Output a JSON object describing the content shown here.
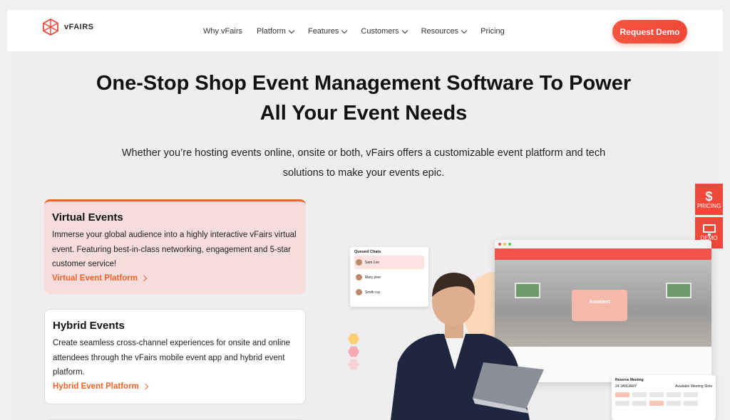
{
  "nav": {
    "logo_text": "vFAIRS",
    "items": [
      {
        "label": "Why vFairs",
        "dropdown": false
      },
      {
        "label": "Platform",
        "dropdown": true
      },
      {
        "label": "Features",
        "dropdown": true
      },
      {
        "label": "Customers",
        "dropdown": true
      },
      {
        "label": "Resources",
        "dropdown": true
      },
      {
        "label": "Pricing",
        "dropdown": false
      }
    ],
    "cta_label": "Request Demo"
  },
  "hero": {
    "title_line1": "One-Stop Shop Event Management Software To Power",
    "title_line2": "All Your Event Needs",
    "subtitle_line1": "Whether you’re hosting events online, onsite or both, vFairs offers a customizable event platform and tech",
    "subtitle_line2": "solutions to make your events epic."
  },
  "cards": [
    {
      "title": "Virtual Events",
      "desc": "Immerse your global audience into a highly interactive vFairs virtual event. Featuring best-in-class networking, engagement and 5-star customer service!",
      "link": "Virtual Event Platform"
    },
    {
      "title": "Hybrid Events",
      "desc": "Create seamless cross-channel experiences for onsite and online attendees through the vFairs mobile event app and hybrid event platform.",
      "link": "Hybrid Event Platform"
    }
  ],
  "side_tabs": {
    "pricing_symbol": "$",
    "pricing_label": "PRICING",
    "demo_label": "DEMO"
  },
  "illustration": {
    "chat_title": "Queued Chats",
    "chat_names": [
      "Sam Lee",
      "Mary jone",
      "Smith roy"
    ],
    "booth_name": "Accolent",
    "meeting_title": "Reserve Meeting",
    "meeting_date": "24 JANUARY",
    "meeting_slots_label": "Available Meeting Slots"
  },
  "colors": {
    "accent": "#f0642a",
    "cta": "#f0483a",
    "active_card_bg": "#f6dcdc"
  }
}
